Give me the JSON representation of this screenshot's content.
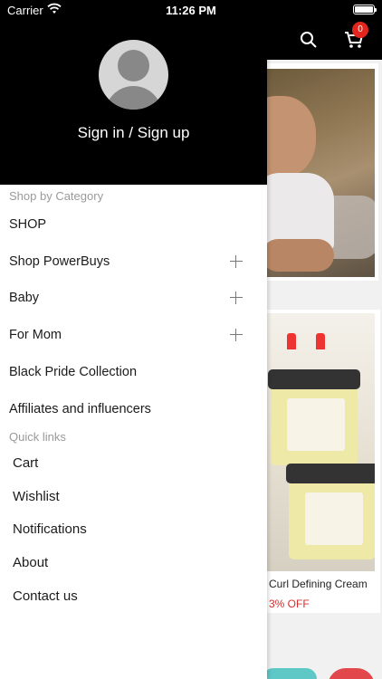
{
  "status_bar": {
    "carrier": "Carrier",
    "time": "11:26 PM",
    "battery_level": 1.0
  },
  "background": {
    "cart_count": "0",
    "product_title": "Curl Defining Cream",
    "product_discount": "3% OFF"
  },
  "drawer": {
    "signin_label": "Sign in / Sign up",
    "category_heading": "Shop by Category",
    "categories": [
      {
        "label": "SHOP",
        "expandable": false
      },
      {
        "label": "Shop PowerBuys",
        "expandable": true
      },
      {
        "label": "Baby",
        "expandable": true
      },
      {
        "label": "For Mom",
        "expandable": true
      },
      {
        "label": "Black Pride Collection",
        "expandable": false
      },
      {
        "label": "Affiliates and influencers",
        "expandable": false
      }
    ],
    "quick_heading": "Quick links",
    "quick_links": [
      {
        "label": "Cart"
      },
      {
        "label": "Wishlist"
      },
      {
        "label": "Notifications"
      },
      {
        "label": "About"
      },
      {
        "label": "Contact us"
      }
    ]
  },
  "colors": {
    "header": "#000000",
    "badge": "#e2261d",
    "discount": "#d32f2f"
  },
  "icons": [
    "wifi-icon",
    "battery-icon",
    "search-icon",
    "cart-icon",
    "plus-icon",
    "avatar-icon"
  ]
}
